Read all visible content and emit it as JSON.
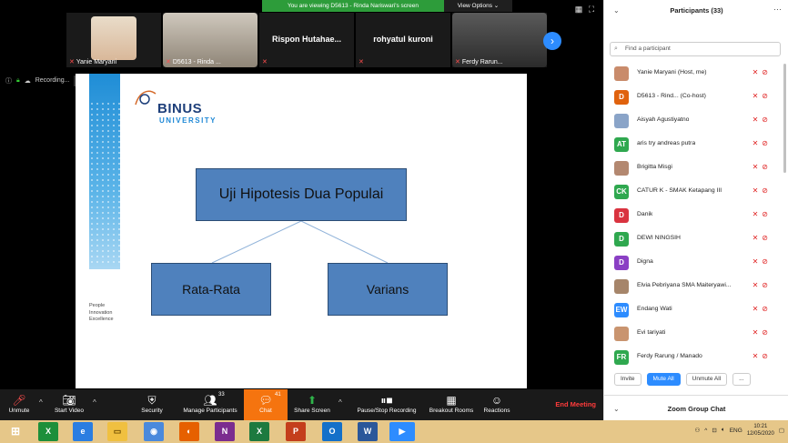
{
  "banner": {
    "text": "You are viewing D5613 - Rinda Nariswari's screen",
    "view_options": "View Options ⌄"
  },
  "thumbnails": [
    {
      "name": "Yanie Maryani",
      "has_video": true
    },
    {
      "name": "D5613 - Rinda ...",
      "has_video": true
    },
    {
      "name": "",
      "big_name": "Rispon  Hutahae...",
      "has_video": false
    },
    {
      "name": "",
      "big_name": "rohyatul kuroni",
      "has_video": false
    },
    {
      "name": "Ferdy Rarun...",
      "has_video": true
    }
  ],
  "recording": {
    "label": "Recording..."
  },
  "slide": {
    "logo_binus": "BINUS",
    "logo_university": "UNIVERSITY",
    "tagline": [
      "People",
      "Innovation",
      "Excellence"
    ],
    "main_box": "Uji Hipotesis Dua Populai",
    "left_box": "Rata-Rata",
    "right_box": "Varians"
  },
  "toolbar": {
    "unmute": "Unmute",
    "start_video": "Start Video",
    "security": "Security",
    "manage_participants": "Manage Participants",
    "participants_count": "33",
    "chat": "Chat",
    "chat_count": "41",
    "share_screen": "Share Screen",
    "record": "Pause/Stop Recording",
    "breakout": "Breakout Rooms",
    "reactions": "Reactions",
    "end_meeting": "End Meeting"
  },
  "panel": {
    "title": "Participants (33)",
    "search_placeholder": "Find a participant",
    "participants": [
      {
        "initials": "",
        "name": "Yanie Maryani (Host, me)",
        "color": "#c98b6b",
        "photo": true
      },
      {
        "initials": "D",
        "name": "D5613 - Rind... (Co-host)",
        "color": "#e0620d",
        "cohost": true
      },
      {
        "initials": "",
        "name": "Aisyah Agustiyatno",
        "color": "#8aa4c8",
        "photo": true
      },
      {
        "initials": "AT",
        "name": "aris try andreas putra",
        "color": "#2fa84f"
      },
      {
        "initials": "",
        "name": "Brigitta Misgi",
        "color": "#b38870",
        "photo": true
      },
      {
        "initials": "CK",
        "name": "CATUR K - SMAK Ketapang III",
        "color": "#2fa84f"
      },
      {
        "initials": "D",
        "name": "Danik",
        "color": "#d9333f"
      },
      {
        "initials": "D",
        "name": "DEWI NINGSIH",
        "color": "#2fa84f"
      },
      {
        "initials": "D",
        "name": "Digna",
        "color": "#8a3fc4"
      },
      {
        "initials": "",
        "name": "Elvia Pebriyana SMA Maiteryawi...",
        "color": "#a6856a",
        "photo": true
      },
      {
        "initials": "EW",
        "name": "Endang Wati",
        "color": "#2d8cff"
      },
      {
        "initials": "",
        "name": "Evi tariyati",
        "color": "#c9946f",
        "photo": true
      },
      {
        "initials": "FR",
        "name": "Ferdy Rarung / Manado",
        "color": "#2fa84f"
      }
    ],
    "invite": "Invite",
    "mute_all": "Mute All",
    "unmute_all": "Unmute All",
    "more": "...",
    "chat_title": "Zoom Group Chat"
  },
  "taskbar": {
    "lang": "ENG",
    "time": "10:21",
    "date": "12/05/2020"
  }
}
